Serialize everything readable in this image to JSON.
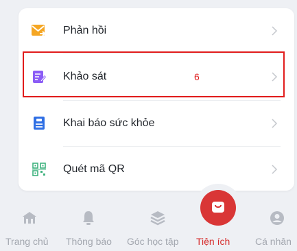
{
  "menu": {
    "items": [
      {
        "label": "Phản hồi",
        "icon": "feedback-mail-icon"
      },
      {
        "label": "Khảo sát",
        "icon": "survey-icon",
        "badge": "6"
      },
      {
        "label": "Khai báo sức khỏe",
        "icon": "health-declaration-icon"
      },
      {
        "label": "Quét mã QR",
        "icon": "qr-scan-icon"
      }
    ]
  },
  "tabbar": {
    "tabs": [
      {
        "label": "Trang chủ",
        "icon": "home-building-icon"
      },
      {
        "label": "Thông báo",
        "icon": "bell-icon"
      },
      {
        "label": "Góc học tập",
        "icon": "layers-icon"
      },
      {
        "label": "Tiện ích",
        "icon": "bag-icon",
        "active": true
      },
      {
        "label": "Cá nhân",
        "icon": "user-icon"
      }
    ]
  },
  "colors": {
    "accent": "#d93636",
    "highlight_border": "#e11b1b",
    "inactive": "#a3a7af"
  }
}
